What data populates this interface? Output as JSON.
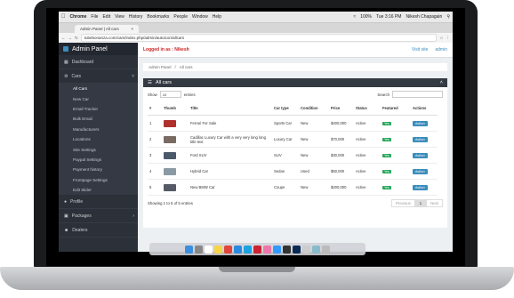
{
  "menubar": {
    "browser": "Chrome",
    "items": [
      "File",
      "Edit",
      "View",
      "History",
      "Bookmarks",
      "People",
      "Window",
      "Help"
    ],
    "battery": "100%",
    "datetime": "Tue 3:16 PM",
    "user": "Nikesh Chapagain"
  },
  "browser": {
    "tab_title": "Admin Panel | All cars",
    "url": "tubebonanza.com/cars/index.php/admin/autoicon/allcars"
  },
  "sidebar": {
    "brand": "Admin Panel",
    "dashboard": "Dashboard",
    "cars": "Cars",
    "sub_items": [
      "All Cars",
      "New Car",
      "Email Tracker",
      "Bulk Email",
      "Manufacturers",
      "Locations",
      "Site Settings",
      "Paypal Settings",
      "Payment history",
      "Frontpage Settings",
      "Edit Slider"
    ],
    "profile": "Profile",
    "packages": "Packages",
    "dealers": "Dealers"
  },
  "topbar": {
    "logged_in": "Logged in as : Nikesh",
    "visit_site": "Visit site",
    "admin": "admin"
  },
  "breadcrumb": {
    "home": "Admin Panel",
    "current": "All cars"
  },
  "panel": {
    "title": "All cars",
    "show_label": "Show",
    "show_value": "10",
    "entries_label": "entries",
    "search_label": "Search"
  },
  "table": {
    "headers": [
      "#",
      "Thumb",
      "Title",
      "Car type",
      "Condition",
      "Price",
      "Status",
      "Featured",
      "Actions"
    ],
    "rows": [
      {
        "num": "1",
        "title": "Ferrari For Sale",
        "type": "Sports Car",
        "condition": "New",
        "price": "$400,000",
        "status": "Active",
        "featured": "Yes",
        "action": "Action",
        "thumb": "#b0302c"
      },
      {
        "num": "2",
        "title": "Cadillac Luxury Car with a very very long long title text",
        "type": "Luxury Car",
        "condition": "New",
        "price": "$70,000",
        "status": "Active",
        "featured": "Yes",
        "action": "Action",
        "thumb": "#7a6b62"
      },
      {
        "num": "3",
        "title": "Ford SUV",
        "type": "SUV",
        "condition": "New",
        "price": "$30,000",
        "status": "Active",
        "featured": "Yes",
        "action": "Action",
        "thumb": "#4b5a6a"
      },
      {
        "num": "4",
        "title": "Hybrid Car",
        "type": "Sedan",
        "condition": "Used",
        "price": "$50,000",
        "status": "Active",
        "featured": "Yes",
        "action": "Action",
        "thumb": "#8a9aa5"
      },
      {
        "num": "5",
        "title": "New BMW Car",
        "type": "Coupe",
        "condition": "New",
        "price": "$200,000",
        "status": "Active",
        "featured": "Yes",
        "action": "Action",
        "thumb": "#555a66"
      }
    ],
    "showing": "Showing 1 to 5 of 5 entries",
    "previous": "Previous",
    "page": "1",
    "next": "Next"
  },
  "colors": {
    "sidebar": "#2c3038",
    "accent": "#3c8dbc",
    "featured": "#26a65b",
    "logged_in": "#cc2222"
  }
}
